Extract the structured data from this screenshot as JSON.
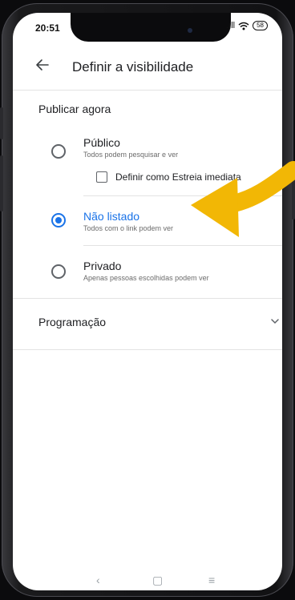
{
  "status_bar": {
    "time": "20:51",
    "battery": "58"
  },
  "header": {
    "title": "Definir a visibilidade"
  },
  "section": {
    "label": "Publicar agora"
  },
  "options": [
    {
      "title": "Público",
      "subtitle": "Todos podem pesquisar e ver",
      "selected": false
    },
    {
      "title": "Não listado",
      "subtitle": "Todos com o link podem ver",
      "selected": true
    },
    {
      "title": "Privado",
      "subtitle": "Apenas pessoas escolhidas podem ver",
      "selected": false
    }
  ],
  "premiere": {
    "label": "Definir como Estreia imediata",
    "checked": false
  },
  "schedule": {
    "label": "Programação"
  },
  "colors": {
    "accent": "#1a73e8",
    "arrow": "#f2b705"
  },
  "icons": [
    "back-arrow-icon",
    "chevron-down-icon",
    "signal-icon",
    "wifi-icon",
    "battery-icon"
  ]
}
